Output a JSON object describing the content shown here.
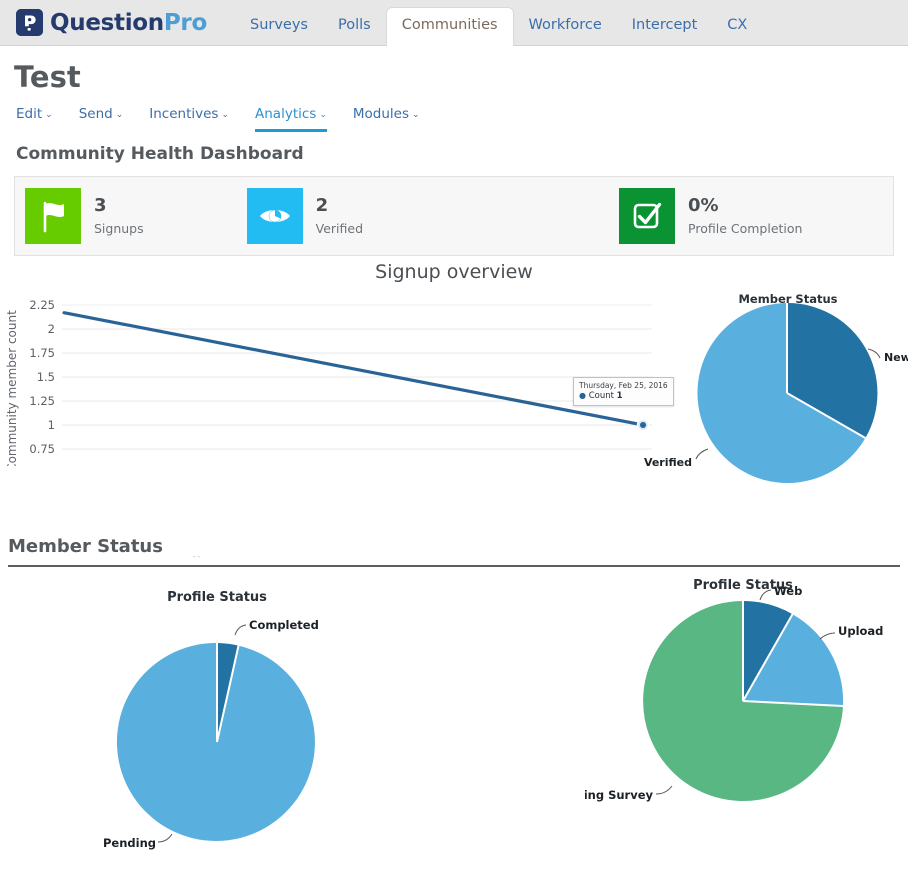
{
  "brand": {
    "name_part1": "Question",
    "name_part2": "Pro",
    "mark_glyph": "P",
    "mark_icon": "questionpro-logo-icon"
  },
  "topnav": {
    "tabs": [
      {
        "label": "Surveys",
        "active": false
      },
      {
        "label": "Polls",
        "active": false
      },
      {
        "label": "Communities",
        "active": true
      },
      {
        "label": "Workforce",
        "active": false
      },
      {
        "label": "Intercept",
        "active": false
      },
      {
        "label": "CX",
        "active": false
      }
    ]
  },
  "page": {
    "title": "Test",
    "submenu": [
      {
        "label": "Edit",
        "caret": "⌄",
        "active": false
      },
      {
        "label": "Send",
        "caret": "⌄",
        "active": false
      },
      {
        "label": "Incentives",
        "caret": "⌄",
        "active": false
      },
      {
        "label": "Analytics",
        "caret": "⌄",
        "active": true
      },
      {
        "label": "Modules",
        "caret": "⌄",
        "active": false
      }
    ],
    "dashboard_title": "Community Health Dashboard",
    "member_status_section_title": "Member Status",
    "artifact_text": "--"
  },
  "stats": [
    {
      "value": "3",
      "label": "Signups",
      "icon": "flag-icon",
      "color": "#66cc00"
    },
    {
      "value": "2",
      "label": "Verified",
      "icon": "eye-icon",
      "color": "#22bcf2"
    },
    {
      "value": "0%",
      "label": "Profile Completion",
      "icon": "checkbox-check-icon",
      "color": "#0a9332"
    }
  ],
  "overview": {
    "title": "Signup overview"
  },
  "tooltip": {
    "date": "Thursday, Feb 25, 2016",
    "series_label": "Count",
    "value": "1",
    "bullet": "●"
  },
  "chart_data": [
    {
      "type": "line",
      "title": "Signup overview",
      "xlabel": "",
      "ylabel": "Community member count",
      "ylim": [
        0.75,
        2.25
      ],
      "yticks": [
        "2.25",
        "2",
        "1.75",
        "1.5",
        "1.25",
        "1",
        "0.75"
      ],
      "ytick_values": [
        2.25,
        2,
        1.75,
        1.5,
        1.25,
        1,
        0.75
      ],
      "grid": true,
      "legend": "none",
      "series": [
        {
          "name": "Count",
          "color": "#2a6496",
          "x": [
            0,
            1
          ],
          "values": [
            2.17,
            1.0
          ]
        }
      ],
      "annotations": [
        {
          "text": "Thursday, Feb 25, 2016",
          "detail": "Count  1",
          "at_x": 1,
          "at_y": 1
        }
      ]
    },
    {
      "type": "pie",
      "title": "Member Status",
      "labels": [
        "New",
        "Verified"
      ],
      "values": [
        33.3,
        66.7
      ],
      "colors": [
        "#2272a3",
        "#59b0de"
      ],
      "legend": "labels-outside"
    },
    {
      "type": "pie",
      "title": "Profile Status",
      "labels": [
        "Completed",
        "Pending"
      ],
      "values": [
        6,
        94
      ],
      "colors": [
        "#2272a3",
        "#59b0de"
      ],
      "legend": "labels-outside"
    },
    {
      "type": "pie",
      "title": "Profile Status",
      "labels": [
        "Web",
        "Upload",
        "Qualifying Survey"
      ],
      "values": [
        8,
        17,
        75
      ],
      "colors": [
        "#2272a3",
        "#59b0de",
        "#58b782"
      ],
      "legend": "labels-outside"
    }
  ]
}
